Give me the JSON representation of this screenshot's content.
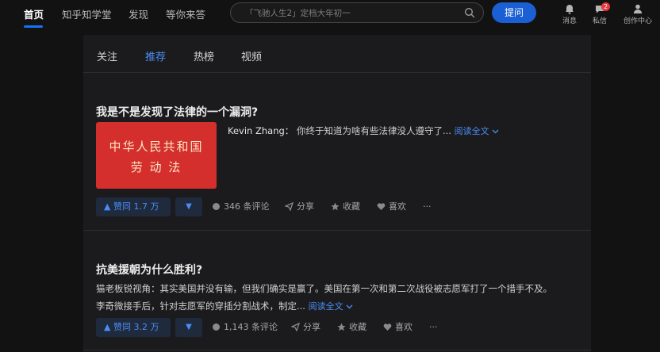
{
  "topbar": {
    "nav": [
      "首页",
      "知乎知学堂",
      "发现",
      "等你来答"
    ],
    "search_placeholder": "「飞驰人生2」定档大年初一",
    "ask_button": "提问",
    "icons": [
      {
        "name": "bell-icon",
        "label": "消息"
      },
      {
        "name": "message-icon",
        "label": "私信",
        "badge": "2"
      },
      {
        "name": "creator-icon",
        "label": "创作中心"
      }
    ]
  },
  "feed_tabs": [
    "关注",
    "推荐",
    "热榜",
    "视频"
  ],
  "cards": [
    {
      "title": "我是不是发现了法律的一个漏洞?",
      "cover_lines": [
        "中华人民共和国",
        "劳 动 法"
      ],
      "author": "Kevin Zhang：",
      "excerpt": "你终于知道为啥有些法律没人遵守了...",
      "read_more": "阅读全文",
      "vote": "赞同 1.7 万",
      "comments": "346 条评论",
      "share": "分享",
      "collect": "收藏",
      "like": "喜欢",
      "more": "···"
    },
    {
      "title": "抗美援朝为什么胜利?",
      "excerpt_line1": "猫老板锐视角：其实美国并没有输，但我们确实是赢了。美国在第一次和第二次战役被志愿军打了一个措手不及。",
      "excerpt_line2": "李奇微接手后，针对志愿军的穿插分割战术，制定...",
      "read_more": "阅读全文",
      "vote": "赞同 3.2 万",
      "comments": "1,143 条评论",
      "share": "分享",
      "collect": "收藏",
      "like": "喜欢",
      "more": "···"
    }
  ],
  "colors": {
    "accent": "#1772f6",
    "link": "#4a8df8",
    "page_bg": "#121212",
    "card_bg": "#1b1b1d",
    "cover_red": "#d42f2c"
  }
}
